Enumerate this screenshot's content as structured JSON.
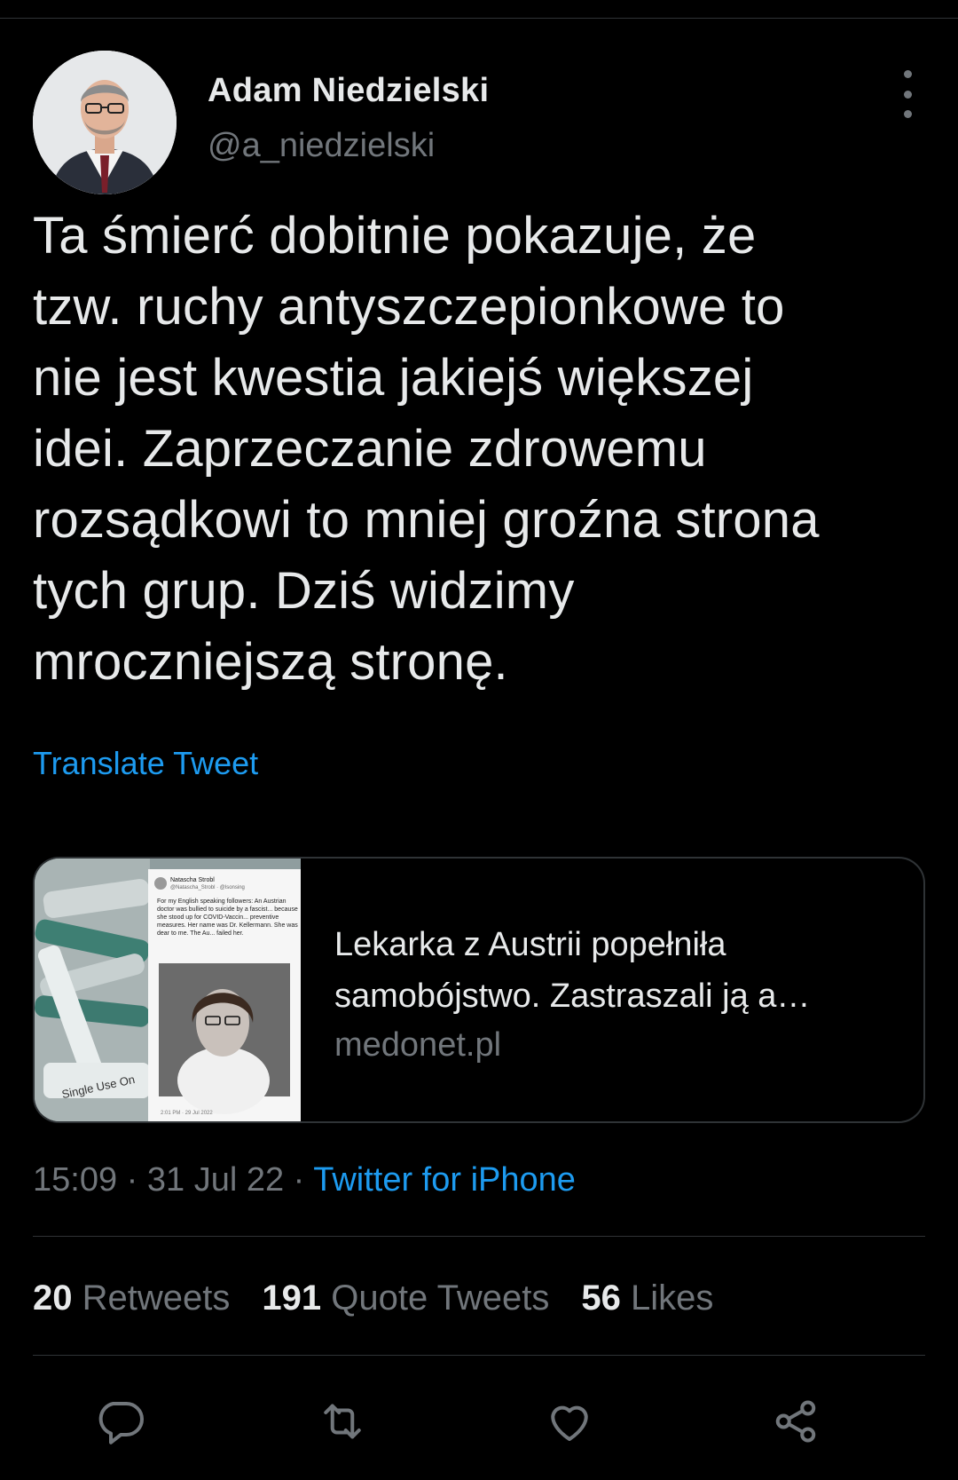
{
  "author": {
    "display_name": "Adam Niedzielski",
    "handle": "@a_niedzielski",
    "avatar_icon": "profile-photo"
  },
  "tweet": {
    "text": "Ta śmierć dobitnie pokazuje, że\ntzw. ruchy antyszczepionkowe to\nnie jest kwestia jakiejś większej\nidei. Zaprzeczanie zdrowemu\nrozsądkowi to mniej groźna strona\ntych grup. Dziś widzimy\nmroczniejszą stronę.",
    "translate_label": "Translate Tweet"
  },
  "link_card": {
    "title": "Lekarka z Austrii popełniła\nsamobójstwo. Zastraszali ją a…",
    "domain": "medonet.pl",
    "thumb_text": {
      "name": "Natascha Strobl",
      "handle": "@Natascha_Strobl · @lsonsing",
      "body": "For my English speaking followers: An Austrian doctor was bullied to suicide by a fascist... because she stood up for COVID-Vaccin... preventive measures. Her name was Dr. Kellermann. She was dear to me. The Au... failed her.",
      "timestamp": "2:01 PM · 29 Jul 2022",
      "syringe_label": "Single Use On"
    }
  },
  "meta": {
    "time": "15:09",
    "separator": "·",
    "date": "31 Jul 22",
    "source": "Twitter for iPhone"
  },
  "stats": {
    "retweets_count": "20",
    "retweets_label": "Retweets",
    "quotes_count": "191",
    "quotes_label": "Quote Tweets",
    "likes_count": "56",
    "likes_label": "Likes"
  },
  "actions": [
    "reply-icon",
    "retweet-icon",
    "like-icon",
    "share-icon"
  ],
  "colors": {
    "background": "#000000",
    "text": "#e7e9ea",
    "muted": "#71767b",
    "accent": "#1d9bf0",
    "border": "#2f3336"
  }
}
